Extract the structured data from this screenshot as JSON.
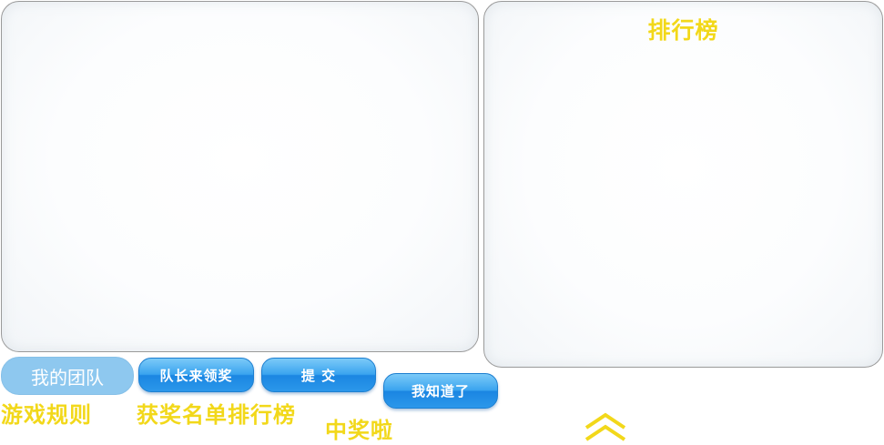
{
  "ranking_panel": {
    "title": "排行榜"
  },
  "buttons": {
    "my_team": "我的团队",
    "captain_claim": "队长来领奖",
    "submit": "提 交",
    "got_it": "我知道了"
  },
  "links": {
    "game_rules": "游戏规则",
    "winners_ranking": "获奖名单排行榜",
    "won_prize": "中奖啦"
  },
  "icons": {
    "scroll_up": "double-chevron-up-icon"
  },
  "colors": {
    "accent_yellow": "#f2d81a",
    "button_blue": "#2b97ea",
    "button_disabled_blue": "#8ec8ef",
    "panel_border": "#9a9a9a"
  }
}
